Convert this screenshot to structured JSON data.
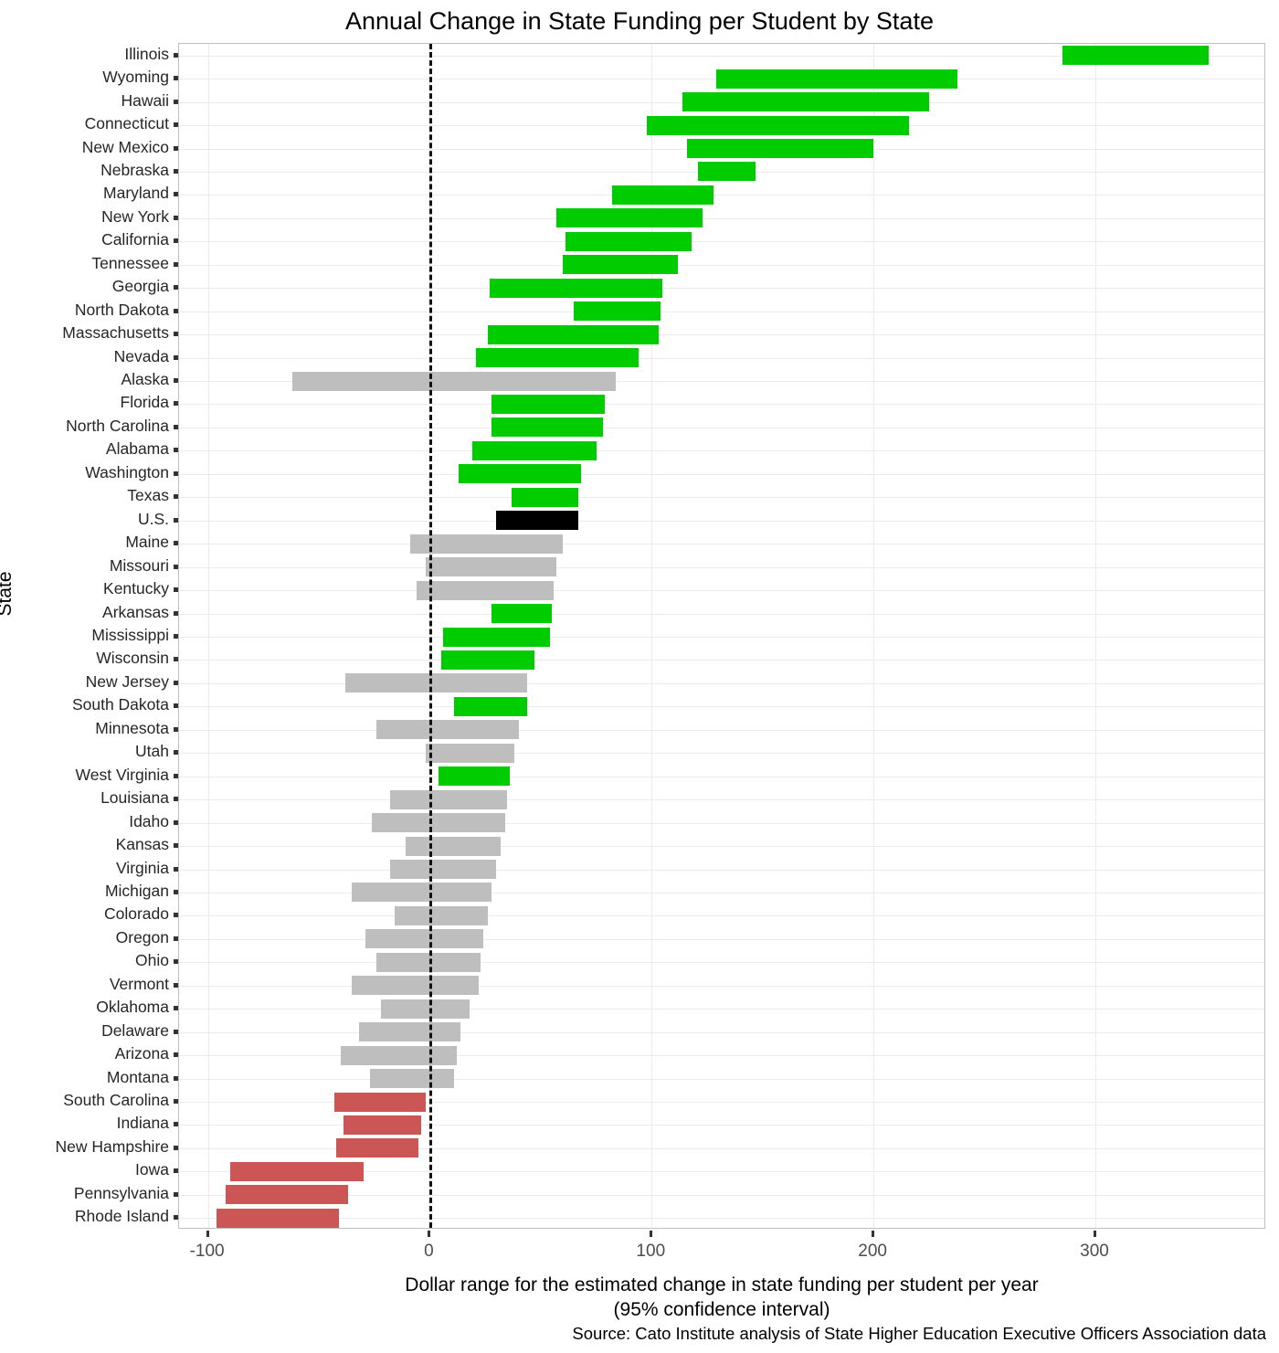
{
  "chart_data": {
    "type": "bar",
    "orientation": "horizontal",
    "title": "Annual Change in State Funding per Student by State",
    "xlabel": "Dollar range for the estimated change in state funding per student per year",
    "xlabel_line2": "(95% confidence interval)",
    "ylabel": "State",
    "source": "Source: Cato Institute analysis of State Higher Education Executive Officers Association data",
    "xlim": [
      -113,
      377
    ],
    "xticks": [
      -100,
      0,
      100,
      200,
      300
    ],
    "xtick_labels": [
      "-100",
      "0",
      "100",
      "200",
      "300"
    ],
    "grid": true,
    "legend": "none",
    "reference_line": 0,
    "colors": {
      "positive": "#00cc00",
      "neutral": "#bebebe",
      "negative": "#cc5555",
      "national": "#000000",
      "grid": "#ebebeb",
      "panel_border": "#bfbfbf"
    },
    "categories": [
      "Illinois",
      "Wyoming",
      "Hawaii",
      "Connecticut",
      "New Mexico",
      "Nebraska",
      "Maryland",
      "New York",
      "California",
      "Tennessee",
      "Georgia",
      "North Dakota",
      "Massachusetts",
      "Nevada",
      "Alaska",
      "Florida",
      "North Carolina",
      "Alabama",
      "Washington",
      "Texas",
      "U.S.",
      "Maine",
      "Missouri",
      "Kentucky",
      "Arkansas",
      "Mississippi",
      "Wisconsin",
      "New Jersey",
      "South Dakota",
      "Minnesota",
      "Utah",
      "West Virginia",
      "Louisiana",
      "Idaho",
      "Kansas",
      "Virginia",
      "Michigan",
      "Colorado",
      "Oregon",
      "Ohio",
      "Vermont",
      "Oklahoma",
      "Delaware",
      "Arizona",
      "Montana",
      "South Carolina",
      "Indiana",
      "New Hampshire",
      "Iowa",
      "Pennsylvania",
      "Rhode Island"
    ],
    "bars": [
      {
        "label": "Illinois",
        "low": 285,
        "high": 351,
        "color": "positive"
      },
      {
        "label": "Wyoming",
        "low": 129,
        "high": 238,
        "color": "positive"
      },
      {
        "label": "Hawaii",
        "low": 114,
        "high": 225,
        "color": "positive"
      },
      {
        "label": "Connecticut",
        "low": 98,
        "high": 216,
        "color": "positive"
      },
      {
        "label": "New Mexico",
        "low": 116,
        "high": 200,
        "color": "positive"
      },
      {
        "label": "Nebraska",
        "low": 121,
        "high": 147,
        "color": "positive"
      },
      {
        "label": "Maryland",
        "low": 82,
        "high": 128,
        "color": "positive"
      },
      {
        "label": "New York",
        "low": 57,
        "high": 123,
        "color": "positive"
      },
      {
        "label": "California",
        "low": 61,
        "high": 118,
        "color": "positive"
      },
      {
        "label": "Tennessee",
        "low": 60,
        "high": 112,
        "color": "positive"
      },
      {
        "label": "Georgia",
        "low": 27,
        "high": 105,
        "color": "positive"
      },
      {
        "label": "North Dakota",
        "low": 65,
        "high": 104,
        "color": "positive"
      },
      {
        "label": "Massachusetts",
        "low": 26,
        "high": 103,
        "color": "positive"
      },
      {
        "label": "Nevada",
        "low": 21,
        "high": 94,
        "color": "positive"
      },
      {
        "label": "Alaska",
        "low": -62,
        "high": 84,
        "color": "neutral"
      },
      {
        "label": "Florida",
        "low": 28,
        "high": 79,
        "color": "positive"
      },
      {
        "label": "North Carolina",
        "low": 28,
        "high": 78,
        "color": "positive"
      },
      {
        "label": "Alabama",
        "low": 19,
        "high": 75,
        "color": "positive"
      },
      {
        "label": "Washington",
        "low": 13,
        "high": 68,
        "color": "positive"
      },
      {
        "label": "Texas",
        "low": 37,
        "high": 67,
        "color": "positive"
      },
      {
        "label": "U.S.",
        "low": 30,
        "high": 67,
        "color": "national"
      },
      {
        "label": "Maine",
        "low": -9,
        "high": 60,
        "color": "neutral"
      },
      {
        "label": "Missouri",
        "low": -2,
        "high": 57,
        "color": "neutral"
      },
      {
        "label": "Kentucky",
        "low": -6,
        "high": 56,
        "color": "neutral"
      },
      {
        "label": "Arkansas",
        "low": 28,
        "high": 55,
        "color": "positive"
      },
      {
        "label": "Mississippi",
        "low": 6,
        "high": 54,
        "color": "positive"
      },
      {
        "label": "Wisconsin",
        "low": 5,
        "high": 47,
        "color": "positive"
      },
      {
        "label": "New Jersey",
        "low": -38,
        "high": 44,
        "color": "neutral"
      },
      {
        "label": "South Dakota",
        "low": 11,
        "high": 44,
        "color": "positive"
      },
      {
        "label": "Minnesota",
        "low": -24,
        "high": 40,
        "color": "neutral"
      },
      {
        "label": "Utah",
        "low": -2,
        "high": 38,
        "color": "neutral"
      },
      {
        "label": "West Virginia",
        "low": 4,
        "high": 36,
        "color": "positive"
      },
      {
        "label": "Louisiana",
        "low": -18,
        "high": 35,
        "color": "neutral"
      },
      {
        "label": "Idaho",
        "low": -26,
        "high": 34,
        "color": "neutral"
      },
      {
        "label": "Kansas",
        "low": -11,
        "high": 32,
        "color": "neutral"
      },
      {
        "label": "Virginia",
        "low": -18,
        "high": 30,
        "color": "neutral"
      },
      {
        "label": "Michigan",
        "low": -35,
        "high": 28,
        "color": "neutral"
      },
      {
        "label": "Colorado",
        "low": -16,
        "high": 26,
        "color": "neutral"
      },
      {
        "label": "Oregon",
        "low": -29,
        "high": 24,
        "color": "neutral"
      },
      {
        "label": "Ohio",
        "low": -24,
        "high": 23,
        "color": "neutral"
      },
      {
        "label": "Vermont",
        "low": -35,
        "high": 22,
        "color": "neutral"
      },
      {
        "label": "Oklahoma",
        "low": -22,
        "high": 18,
        "color": "neutral"
      },
      {
        "label": "Delaware",
        "low": -32,
        "high": 14,
        "color": "neutral"
      },
      {
        "label": "Arizona",
        "low": -40,
        "high": 12,
        "color": "neutral"
      },
      {
        "label": "Montana",
        "low": -27,
        "high": 11,
        "color": "neutral"
      },
      {
        "label": "South Carolina",
        "low": -43,
        "high": -2,
        "color": "negative"
      },
      {
        "label": "Indiana",
        "low": -39,
        "high": -4,
        "color": "negative"
      },
      {
        "label": "New Hampshire",
        "low": -42,
        "high": -5,
        "color": "negative"
      },
      {
        "label": "Iowa",
        "low": -90,
        "high": -30,
        "color": "negative"
      },
      {
        "label": "Pennsylvania",
        "low": -92,
        "high": -37,
        "color": "negative"
      },
      {
        "label": "Rhode Island",
        "low": -96,
        "high": -41,
        "color": "negative"
      }
    ]
  }
}
